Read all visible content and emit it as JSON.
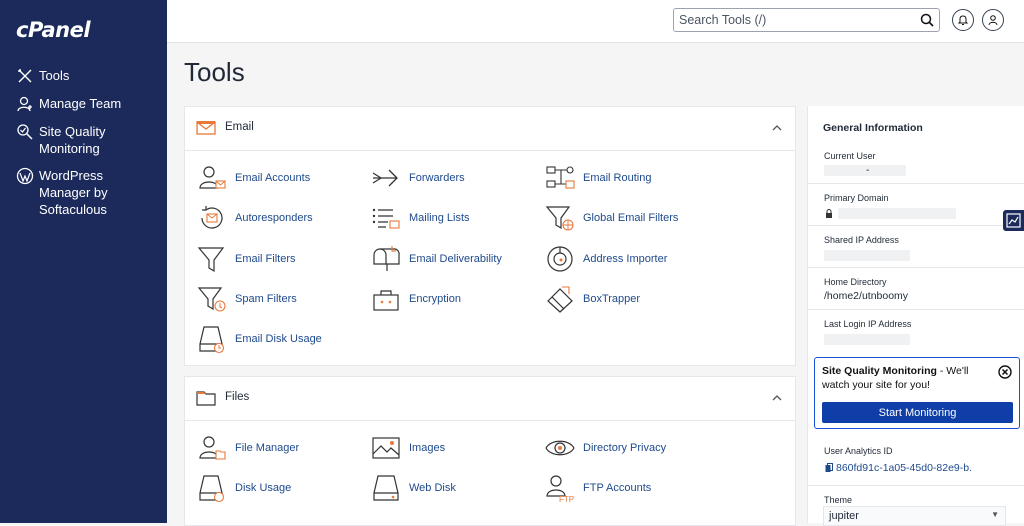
{
  "sidebar": {
    "logo": "cPanel",
    "items": [
      {
        "label": "Tools",
        "icon": "tools-icon"
      },
      {
        "label": "Manage Team",
        "icon": "team-icon"
      },
      {
        "label": "Site Quality Monitoring",
        "icon": "site-quality-icon"
      },
      {
        "label": "WordPress Manager by Softaculous",
        "icon": "wordpress-icon"
      }
    ]
  },
  "topbar": {
    "search_placeholder": "Search Tools (/)"
  },
  "page": {
    "title": "Tools"
  },
  "email_panel": {
    "title": "Email",
    "tools": [
      {
        "label": "Email Accounts"
      },
      {
        "label": "Forwarders"
      },
      {
        "label": "Email Routing"
      },
      {
        "label": "Autoresponders"
      },
      {
        "label": "Mailing Lists"
      },
      {
        "label": "Global Email Filters"
      },
      {
        "label": "Email Filters"
      },
      {
        "label": "Email Deliverability"
      },
      {
        "label": "Address Importer"
      },
      {
        "label": "Spam Filters"
      },
      {
        "label": "Encryption"
      },
      {
        "label": "BoxTrapper"
      },
      {
        "label": "Email Disk Usage"
      }
    ]
  },
  "files_panel": {
    "title": "Files",
    "tools": [
      {
        "label": "File Manager"
      },
      {
        "label": "Images"
      },
      {
        "label": "Directory Privacy"
      },
      {
        "label": "Disk Usage"
      },
      {
        "label": "Web Disk"
      },
      {
        "label": "FTP Accounts"
      }
    ]
  },
  "general_info": {
    "title": "General Information",
    "current_user_label": "Current User",
    "current_user_value": "-",
    "primary_domain_label": "Primary Domain",
    "shared_ip_label": "Shared IP Address",
    "home_dir_label": "Home Directory",
    "home_dir_value": "/home2/utnboomy",
    "last_login_label": "Last Login IP Address",
    "analytics_label": "User Analytics ID",
    "analytics_value": "860fd91c-1a05-45d0-82e9-b...",
    "theme_label": "Theme",
    "theme_value": "jupiter"
  },
  "sqm_popup": {
    "title": "Site Quality Monitoring",
    "text": " - We'll watch your site for you!",
    "button": "Start Monitoring"
  },
  "colors": {
    "sidebar": "#1b2a5b",
    "link": "#1e4a8c",
    "accent_orange": "#e8793a",
    "button_blue": "#0f3ea8"
  }
}
